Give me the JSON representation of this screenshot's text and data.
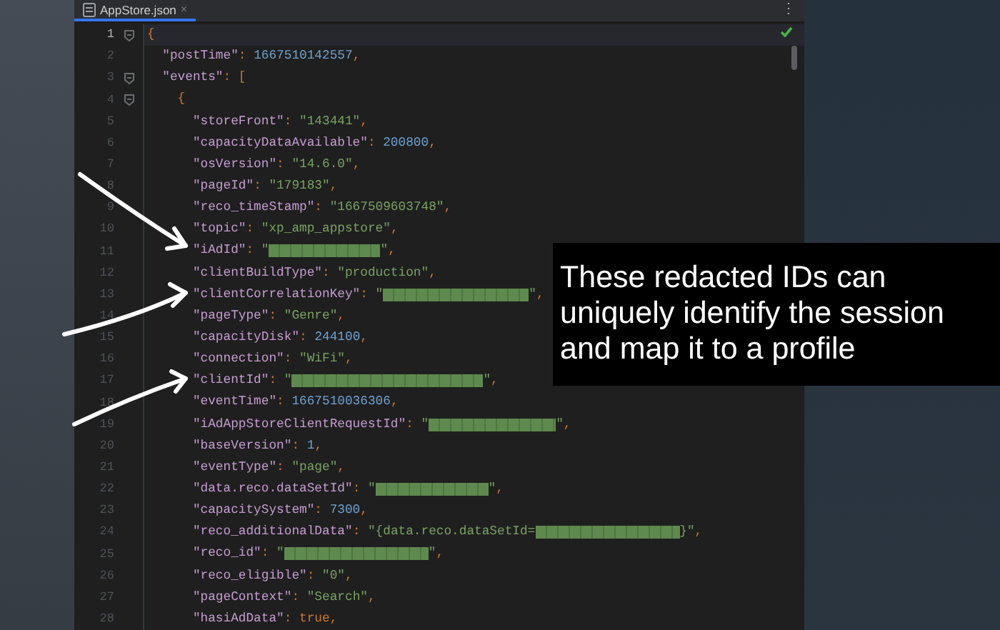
{
  "editor": {
    "tab": {
      "label": "AppStore.json",
      "selected": true,
      "close": "×"
    },
    "menu_glyph": "⋮",
    "inspection_ok": true,
    "lines": [
      {
        "number": "1",
        "current": true,
        "fold": true,
        "segments": [
          {
            "kind": "punct",
            "text": "{"
          }
        ]
      },
      {
        "number": "2",
        "current": false,
        "fold": false,
        "segments": [
          {
            "kind": "key",
            "text": "  \"postTime\""
          },
          {
            "kind": "punct",
            "text": ": "
          },
          {
            "kind": "number",
            "text": "1667510142557"
          },
          {
            "kind": "punct",
            "text": ","
          }
        ]
      },
      {
        "number": "3",
        "current": false,
        "fold": true,
        "segments": [
          {
            "kind": "key",
            "text": "  \"events\""
          },
          {
            "kind": "punct",
            "text": ": ["
          }
        ]
      },
      {
        "number": "4",
        "current": false,
        "fold": true,
        "segments": [
          {
            "kind": "punct",
            "text": "    {"
          }
        ]
      },
      {
        "number": "5",
        "current": false,
        "fold": false,
        "segments": [
          {
            "kind": "key",
            "text": "      \"storeFront\""
          },
          {
            "kind": "punct",
            "text": ": "
          },
          {
            "kind": "string",
            "text": "\"143441\""
          },
          {
            "kind": "punct",
            "text": ","
          }
        ]
      },
      {
        "number": "6",
        "current": false,
        "fold": false,
        "segments": [
          {
            "kind": "key",
            "text": "      \"capacityDataAvailable\""
          },
          {
            "kind": "punct",
            "text": ": "
          },
          {
            "kind": "number",
            "text": "200800"
          },
          {
            "kind": "punct",
            "text": ","
          }
        ]
      },
      {
        "number": "7",
        "current": false,
        "fold": false,
        "segments": [
          {
            "kind": "key",
            "text": "      \"osVersion\""
          },
          {
            "kind": "punct",
            "text": ": "
          },
          {
            "kind": "string",
            "text": "\"14.6.0\""
          },
          {
            "kind": "punct",
            "text": ","
          }
        ]
      },
      {
        "number": "8",
        "current": false,
        "fold": false,
        "segments": [
          {
            "kind": "key",
            "text": "      \"pageId\""
          },
          {
            "kind": "punct",
            "text": ": "
          },
          {
            "kind": "string",
            "text": "\"179183\""
          },
          {
            "kind": "punct",
            "text": ","
          }
        ]
      },
      {
        "number": "9",
        "current": false,
        "fold": false,
        "segments": [
          {
            "kind": "key",
            "text": "      \"reco_timeStamp\""
          },
          {
            "kind": "punct",
            "text": ": "
          },
          {
            "kind": "string",
            "text": "\"1667509603748\""
          },
          {
            "kind": "punct",
            "text": ","
          }
        ]
      },
      {
        "number": "10",
        "current": false,
        "fold": false,
        "segments": [
          {
            "kind": "key",
            "text": "      \"topic\""
          },
          {
            "kind": "punct",
            "text": ": "
          },
          {
            "kind": "string",
            "text": "\"xp_amp_appstore\""
          },
          {
            "kind": "punct",
            "text": ","
          }
        ]
      },
      {
        "number": "11",
        "current": false,
        "fold": false,
        "segments": [
          {
            "kind": "key",
            "text": "      \"iAdId\""
          },
          {
            "kind": "punct",
            "text": ": "
          },
          {
            "kind": "string",
            "text": "\""
          },
          {
            "kind": "redacted"
          },
          {
            "kind": "string",
            "text": "\""
          },
          {
            "kind": "punct",
            "text": ","
          }
        ]
      },
      {
        "number": "12",
        "current": false,
        "fold": false,
        "segments": [
          {
            "kind": "key",
            "text": "      \"clientBuildType\""
          },
          {
            "kind": "punct",
            "text": ": "
          },
          {
            "kind": "string",
            "text": "\"production\""
          },
          {
            "kind": "punct",
            "text": ","
          }
        ]
      },
      {
        "number": "13",
        "current": false,
        "fold": false,
        "segments": [
          {
            "kind": "key",
            "text": "      \"clientCorrelationKey\""
          },
          {
            "kind": "punct",
            "text": ": "
          },
          {
            "kind": "string",
            "text": "\""
          },
          {
            "kind": "redacted"
          },
          {
            "kind": "string",
            "text": "\""
          },
          {
            "kind": "punct",
            "text": ","
          }
        ]
      },
      {
        "number": "14",
        "current": false,
        "fold": false,
        "segments": [
          {
            "kind": "key",
            "text": "      \"pageType\""
          },
          {
            "kind": "punct",
            "text": ": "
          },
          {
            "kind": "string",
            "text": "\"Genre\""
          },
          {
            "kind": "punct",
            "text": ","
          }
        ]
      },
      {
        "number": "15",
        "current": false,
        "fold": false,
        "segments": [
          {
            "kind": "key",
            "text": "      \"capacityDisk\""
          },
          {
            "kind": "punct",
            "text": ": "
          },
          {
            "kind": "number",
            "text": "244100"
          },
          {
            "kind": "punct",
            "text": ","
          }
        ]
      },
      {
        "number": "16",
        "current": false,
        "fold": false,
        "segments": [
          {
            "kind": "key",
            "text": "      \"connection\""
          },
          {
            "kind": "punct",
            "text": ": "
          },
          {
            "kind": "string",
            "text": "\"WiFi\""
          },
          {
            "kind": "punct",
            "text": ","
          }
        ]
      },
      {
        "number": "17",
        "current": false,
        "fold": false,
        "segments": [
          {
            "kind": "key",
            "text": "      \"clientId\""
          },
          {
            "kind": "punct",
            "text": ": "
          },
          {
            "kind": "string",
            "text": "\""
          },
          {
            "kind": "redacted"
          },
          {
            "kind": "string",
            "text": "\""
          },
          {
            "kind": "punct",
            "text": ","
          }
        ]
      },
      {
        "number": "18",
        "current": false,
        "fold": false,
        "segments": [
          {
            "kind": "key",
            "text": "      \"eventTime\""
          },
          {
            "kind": "punct",
            "text": ": "
          },
          {
            "kind": "number",
            "text": "1667510036306"
          },
          {
            "kind": "punct",
            "text": ","
          }
        ]
      },
      {
        "number": "19",
        "current": false,
        "fold": false,
        "segments": [
          {
            "kind": "key",
            "text": "      \"iAdAppStoreClientRequestId\""
          },
          {
            "kind": "punct",
            "text": ": "
          },
          {
            "kind": "string",
            "text": "\""
          },
          {
            "kind": "redacted"
          },
          {
            "kind": "string",
            "text": "\""
          },
          {
            "kind": "punct",
            "text": ","
          }
        ]
      },
      {
        "number": "20",
        "current": false,
        "fold": false,
        "segments": [
          {
            "kind": "key",
            "text": "      \"baseVersion\""
          },
          {
            "kind": "punct",
            "text": ": "
          },
          {
            "kind": "number",
            "text": "1"
          },
          {
            "kind": "punct",
            "text": ","
          }
        ]
      },
      {
        "number": "21",
        "current": false,
        "fold": false,
        "segments": [
          {
            "kind": "key",
            "text": "      \"eventType\""
          },
          {
            "kind": "punct",
            "text": ": "
          },
          {
            "kind": "string",
            "text": "\"page\""
          },
          {
            "kind": "punct",
            "text": ","
          }
        ]
      },
      {
        "number": "22",
        "current": false,
        "fold": false,
        "segments": [
          {
            "kind": "key",
            "text": "      \"data.reco.dataSetId\""
          },
          {
            "kind": "punct",
            "text": ": "
          },
          {
            "kind": "string",
            "text": "\""
          },
          {
            "kind": "redacted"
          },
          {
            "kind": "string",
            "text": "\""
          },
          {
            "kind": "punct",
            "text": ","
          }
        ]
      },
      {
        "number": "23",
        "current": false,
        "fold": false,
        "segments": [
          {
            "kind": "key",
            "text": "      \"capacitySystem\""
          },
          {
            "kind": "punct",
            "text": ": "
          },
          {
            "kind": "number",
            "text": "7300"
          },
          {
            "kind": "punct",
            "text": ","
          }
        ]
      },
      {
        "number": "24",
        "current": false,
        "fold": false,
        "segments": [
          {
            "kind": "key",
            "text": "      \"reco_additionalData\""
          },
          {
            "kind": "punct",
            "text": ": "
          },
          {
            "kind": "string",
            "text": "\"{data.reco.dataSetId="
          },
          {
            "kind": "redacted"
          },
          {
            "kind": "string",
            "text": "}\""
          },
          {
            "kind": "punct",
            "text": ","
          }
        ]
      },
      {
        "number": "25",
        "current": false,
        "fold": false,
        "segments": [
          {
            "kind": "key",
            "text": "      \"reco_id\""
          },
          {
            "kind": "punct",
            "text": ": "
          },
          {
            "kind": "string",
            "text": "\""
          },
          {
            "kind": "redacted"
          },
          {
            "kind": "string",
            "text": "\""
          },
          {
            "kind": "punct",
            "text": ","
          }
        ]
      },
      {
        "number": "26",
        "current": false,
        "fold": false,
        "segments": [
          {
            "kind": "key",
            "text": "      \"reco_eligible\""
          },
          {
            "kind": "punct",
            "text": ": "
          },
          {
            "kind": "string",
            "text": "\"0\""
          },
          {
            "kind": "punct",
            "text": ","
          }
        ]
      },
      {
        "number": "27",
        "current": false,
        "fold": false,
        "segments": [
          {
            "kind": "key",
            "text": "      \"pageContext\""
          },
          {
            "kind": "punct",
            "text": ": "
          },
          {
            "kind": "string",
            "text": "\"Search\""
          },
          {
            "kind": "punct",
            "text": ","
          }
        ]
      },
      {
        "number": "28",
        "current": false,
        "fold": false,
        "segments": [
          {
            "kind": "key",
            "text": "      \"hasiAdData\""
          },
          {
            "kind": "punct",
            "text": ": "
          },
          {
            "kind": "bool",
            "text": "true"
          },
          {
            "kind": "punct",
            "text": ","
          }
        ]
      }
    ]
  },
  "caption": "These redacted IDs can uniquely identify the session and map it to a profile"
}
